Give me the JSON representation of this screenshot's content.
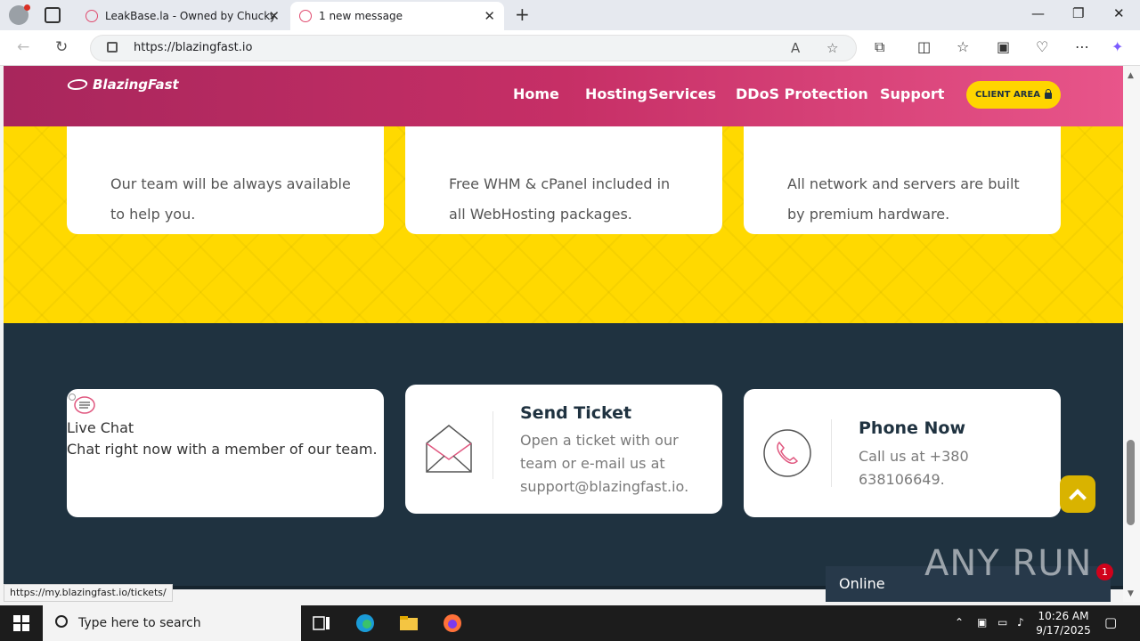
{
  "browser": {
    "tabs": [
      {
        "title": "LeakBase.la - Owned by Chucky",
        "active": false
      },
      {
        "title": "1 new message",
        "active": true
      }
    ],
    "new_tab_label": "+",
    "url": "https://blazingfast.io",
    "status_url": "https://my.blazingfast.io/tickets/"
  },
  "site": {
    "logo": "BlazingFast",
    "nav": [
      "Home",
      "Hosting",
      "Services",
      "DDoS Protection",
      "Support"
    ],
    "client_area": "CLIENT AREA",
    "features": [
      {
        "text": "Our team will be always available to help you."
      },
      {
        "text": "Free WHM & cPanel included in all WebHosting packages."
      },
      {
        "text": "All network and servers are built by premium hardware."
      }
    ],
    "contact": {
      "live_chat": {
        "title": "Live Chat",
        "desc": "Chat right now with a member of our team."
      },
      "send_ticket": {
        "title": "Send Ticket",
        "desc": "Open a ticket with our team or e-mail us at support@blazingfast.io."
      },
      "phone": {
        "title": "Phone Now",
        "desc": "Call us at +380 638106649."
      }
    },
    "chat_status": "Online",
    "chat_badge": "1"
  },
  "watermark": "ANY RUN",
  "taskbar": {
    "search_placeholder": "Type here to search",
    "time": "10:26 AM",
    "date": "9/17/2025"
  },
  "colors": {
    "header_start": "#a8265c",
    "header_end": "#e8558a",
    "yellow": "#ffd900",
    "dark": "#1f3240",
    "accent": "#ffd500"
  }
}
